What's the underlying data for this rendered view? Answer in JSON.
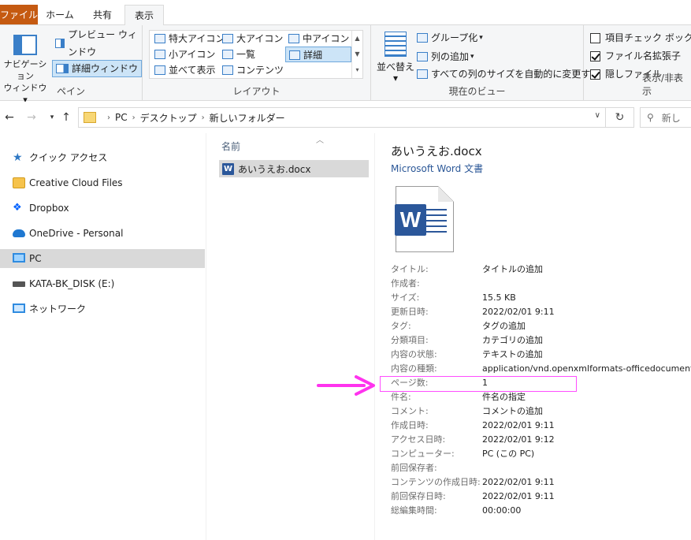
{
  "ribbon": {
    "tabs": [
      {
        "label": "ファイル"
      },
      {
        "label": "ホーム"
      },
      {
        "label": "共有"
      },
      {
        "label": "表示"
      }
    ],
    "pane": {
      "nav_pane_label": "ナビゲーション\nウィンドウ▾",
      "preview_label": "プレビュー ウィンドウ",
      "details_label": "詳細ウィンドウ",
      "group_label": "ペイン"
    },
    "layout": {
      "items": [
        {
          "label": "特大アイコン"
        },
        {
          "label": "大アイコン"
        },
        {
          "label": "中アイコン"
        },
        {
          "label": "小アイコン"
        },
        {
          "label": "一覧"
        },
        {
          "label": "詳細"
        },
        {
          "label": "並べて表示"
        },
        {
          "label": "コンテンツ"
        }
      ],
      "selected": "詳細",
      "group_label": "レイアウト"
    },
    "current_view": {
      "sort_label": "並べ替え",
      "group_by": "グループ化",
      "add_columns": "列の追加",
      "fit_columns": "すべての列のサイズを自動的に変更する",
      "group_label": "現在のビュー"
    },
    "show_hide": {
      "item_checkboxes": "項目チェック ボックス",
      "file_extensions": "ファイル名拡張子",
      "hidden_items": "隠しファイル",
      "item_checkboxes_checked": false,
      "file_extensions_checked": true,
      "hidden_items_checked": true,
      "group_label": "表示/非表示"
    }
  },
  "address": {
    "crumbs": [
      "PC",
      "デスクトップ",
      "新しいフォルダー"
    ],
    "search_placeholder": "新し"
  },
  "nav": {
    "items": [
      {
        "label": "クイック アクセス",
        "icon": "star-icon"
      },
      {
        "label": "Creative Cloud Files",
        "icon": "creative-cloud-icon"
      },
      {
        "label": "Dropbox",
        "icon": "dropbox-icon"
      },
      {
        "label": "OneDrive - Personal",
        "icon": "onedrive-icon"
      },
      {
        "label": "PC",
        "icon": "pc-icon"
      },
      {
        "label": "KATA-BK_DISK (E:)",
        "icon": "drive-icon"
      },
      {
        "label": "ネットワーク",
        "icon": "network-icon"
      }
    ],
    "selected": "PC"
  },
  "files": {
    "column_name": "名前",
    "items": [
      {
        "name": "あいうえお.docx"
      }
    ]
  },
  "details": {
    "filename": "あいうえお.docx",
    "filetype": "Microsoft Word 文書",
    "properties": [
      {
        "label": "タイトル:",
        "value": "タイトルの追加"
      },
      {
        "label": "作成者:",
        "value": ""
      },
      {
        "label": "サイズ:",
        "value": "15.5 KB"
      },
      {
        "label": "更新日時:",
        "value": "2022/02/01 9:11"
      },
      {
        "label": "タグ:",
        "value": "タグの追加"
      },
      {
        "label": "分類項目:",
        "value": "カテゴリの追加"
      },
      {
        "label": "内容の状態:",
        "value": "テキストの追加"
      },
      {
        "label": "内容の種類:",
        "value": "application/vnd.openxmlformats-officedocument.w"
      },
      {
        "label": "ページ数:",
        "value": "1"
      },
      {
        "label": "件名:",
        "value": "件名の指定"
      },
      {
        "label": "コメント:",
        "value": "コメントの追加"
      },
      {
        "label": "作成日時:",
        "value": "2022/02/01 9:11"
      },
      {
        "label": "アクセス日時:",
        "value": "2022/02/01 9:12"
      },
      {
        "label": "コンピューター:",
        "value": "PC (この PC)"
      },
      {
        "label": "前回保存者:",
        "value": ""
      },
      {
        "label": "コンテンツの作成日時:",
        "value": "2022/02/01 9:11"
      },
      {
        "label": "前回保存日時:",
        "value": "2022/02/01 9:11"
      },
      {
        "label": "総編集時間:",
        "value": "00:00:00"
      }
    ],
    "highlighted_property": "ページ数:"
  },
  "colors": {
    "file_tab": "#c55a11",
    "selection": "#cce4f7",
    "annotation": "#ff4dff",
    "word_blue": "#2b579a"
  }
}
